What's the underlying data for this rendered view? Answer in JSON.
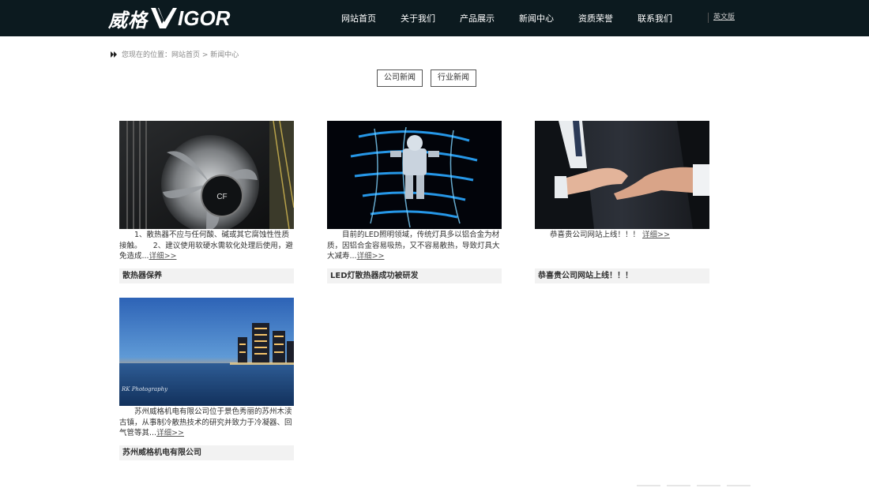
{
  "logo": {
    "cn": "威格",
    "en": "IGOR"
  },
  "nav": {
    "items": [
      {
        "label": "网站首页"
      },
      {
        "label": "关于我们"
      },
      {
        "label": "产品展示"
      },
      {
        "label": "新闻中心"
      },
      {
        "label": "资质荣誉"
      },
      {
        "label": "联系我们"
      }
    ],
    "lang": "英文版"
  },
  "breadcrumb": "您现在的位置：网站首页 > 新闻中心",
  "tabs": [
    {
      "label": "公司新闻"
    },
    {
      "label": "行业新闻"
    }
  ],
  "cards": [
    {
      "desc": "　　1、散热器不应与任何酸、碱或其它腐蚀性性质接触。　　2、建议使用软硬水需软化处理后使用，避免造成...",
      "more": "详细>>",
      "title": "散热器保养",
      "image": "cpu-cooler-photo"
    },
    {
      "desc": "　　目前的LED照明领域，传统灯具多以铝合金为材质，因铝合金容易吸热，又不容易散热，导致灯具大大减寿...",
      "more": "详细>>",
      "title": "LED灯散热器成功被研发",
      "image": "led-light-painting-photo"
    },
    {
      "desc": "　　恭喜贵公司网站上线！！！",
      "more": "详细>>",
      "title": "恭喜贵公司网站上线！！！",
      "image": "handshake-photo"
    },
    {
      "desc": "　　苏州威格机电有限公司位于景色秀丽的苏州木渎古镇，从事制冷散热技术的研究并致力于冷凝器、回气管等其...",
      "more": "详细>>",
      "title": "苏州威格机电有限公司",
      "image": "city-skyline-photo",
      "watermark": "RK Photography"
    }
  ],
  "colors": {
    "header_bg": "#0c1a1f",
    "title_bar_bg": "#f2f2f2"
  }
}
